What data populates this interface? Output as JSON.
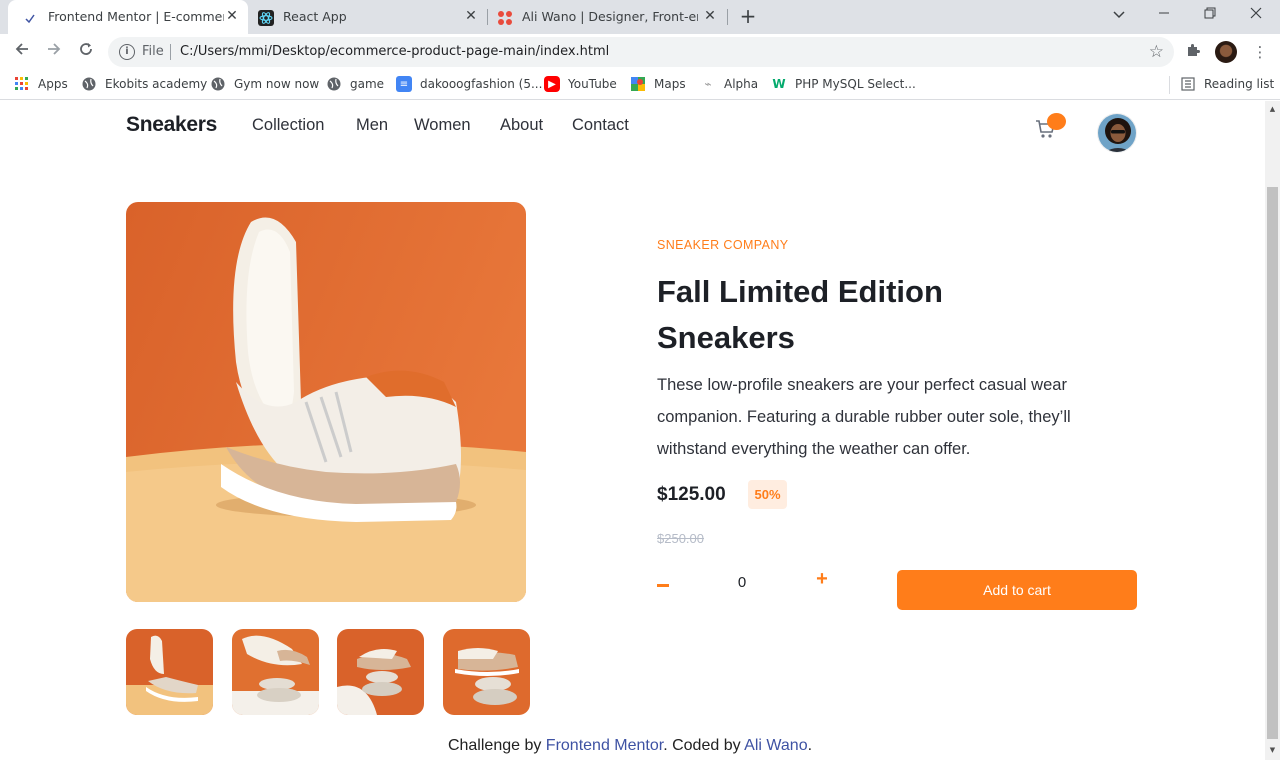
{
  "browser": {
    "tabs": [
      {
        "title": "Frontend Mentor | E-commerce p",
        "active": true
      },
      {
        "title": "React App",
        "active": false
      },
      {
        "title": "Ali Wano | Designer, Front-end D",
        "active": false
      }
    ],
    "omnibox": {
      "scheme_label": "File",
      "url": "C:/Users/mmi/Desktop/ecommerce-product-page-main/index.html"
    },
    "bookmarks": [
      {
        "label": "Apps",
        "icon": "apps-grid-icon"
      },
      {
        "label": "Ekobits academy",
        "icon": "globe-icon"
      },
      {
        "label": "Gym now now",
        "icon": "globe-icon"
      },
      {
        "label": "game",
        "icon": "globe-icon"
      },
      {
        "label": "dakooogfashion (5...",
        "icon": "doc-icon"
      },
      {
        "label": "YouTube",
        "icon": "youtube-icon"
      },
      {
        "label": "Maps",
        "icon": "maps-icon"
      },
      {
        "label": "Alpha",
        "icon": "alpha-icon"
      },
      {
        "label": "PHP MySQL Select...",
        "icon": "w3-icon"
      }
    ],
    "reading_list": "Reading list"
  },
  "site": {
    "logo": "Sneakers",
    "nav": [
      "Collection",
      "Men",
      "Women",
      "About",
      "Contact"
    ],
    "accent": "#ff7d1a"
  },
  "product": {
    "company": "SNEAKER COMPANY",
    "title": "Fall Limited Edition Sneakers",
    "description": "These low-profile sneakers are your perfect casual wear companion. Featuring a durable rubber outer sole, they’ll withstand everything the weather can offer.",
    "price": "$125.00",
    "discount": "50%",
    "old_price": "$250.00",
    "quantity": "0",
    "add_to_cart": "Add to cart"
  },
  "footer": {
    "prefix": "Challenge by ",
    "mentor": "Frontend Mentor",
    "middle": ". Coded by ",
    "author": "Ali Wano",
    "suffix": "."
  }
}
